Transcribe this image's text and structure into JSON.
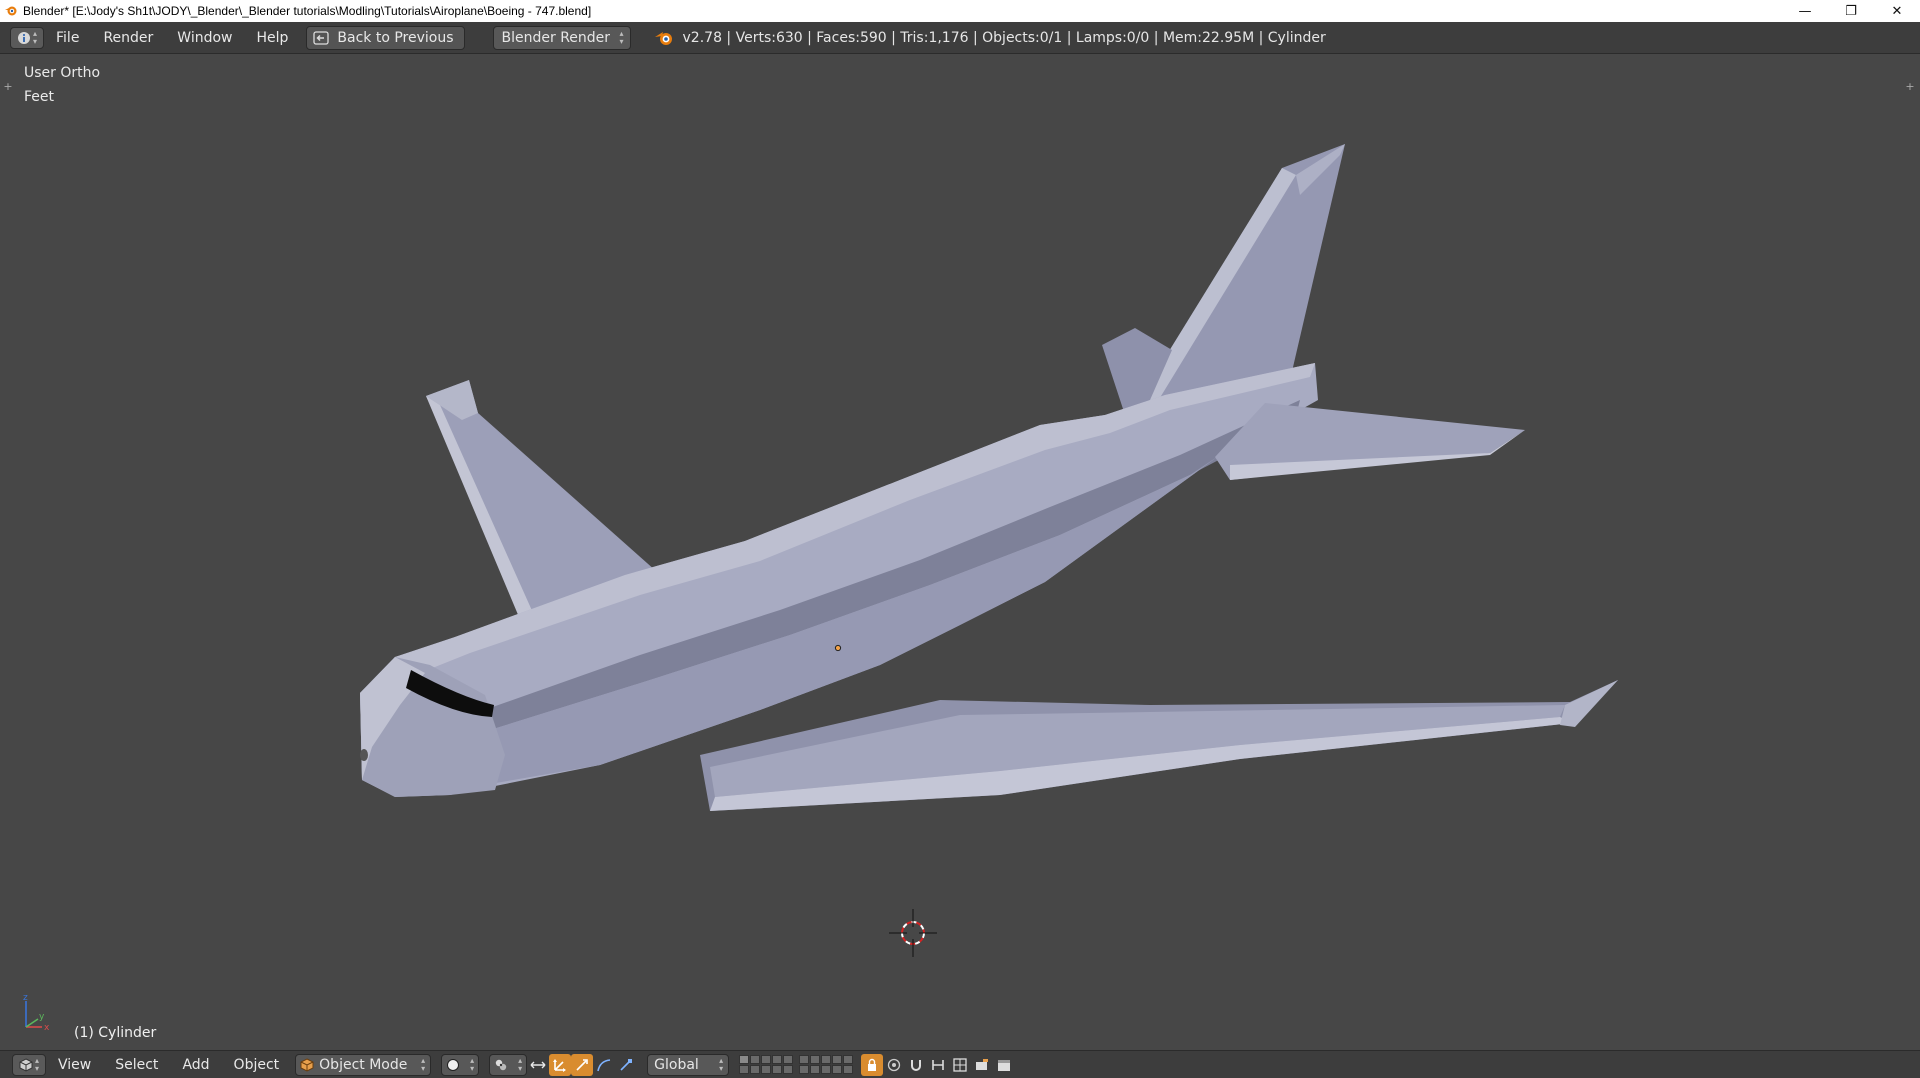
{
  "window": {
    "title": "Blender* [E:\\Jody's Sh1t\\JODY\\_Blender\\_Blender tutorials\\Modling\\Tutorials\\Airoplane\\Boeing - 747.blend]",
    "minimize": "—",
    "maximize": "❐",
    "close": "✕"
  },
  "info_header": {
    "menus": [
      "File",
      "Render",
      "Window",
      "Help"
    ],
    "back_label": "Back to Previous",
    "render_engine": "Blender Render",
    "stats": "v2.78 | Verts:630 | Faces:590 | Tris:1,176 | Objects:0/1 | Lamps:0/0 | Mem:22.95M | Cylinder"
  },
  "viewport": {
    "view_name": "User Ortho",
    "units": "Feet",
    "active_object": "(1) Cylinder",
    "gizmo": {
      "x": "x",
      "y": "y",
      "z": "z"
    }
  },
  "view_header": {
    "menus": [
      "View",
      "Select",
      "Add",
      "Object"
    ],
    "mode": "Object Mode",
    "orientation": "Global"
  },
  "icons": {
    "info_editor": "info-icon",
    "back": "back-icon",
    "blender_logo": "blender-logo-icon",
    "cube": "cube-icon",
    "shading": "solid-sphere-icon",
    "pivot": "pivot-icon",
    "manipulator": "manipulator-icon",
    "translate": "translate-icon",
    "rotate": "rotate-icon",
    "scale": "scale-icon",
    "render_preview": "render-icon",
    "camera": "camera-icon",
    "3d_cursor": "3d-cursor-icon"
  },
  "colors": {
    "ui_bg": "#3d3d3d",
    "viewport_bg": "#474747",
    "active_tool": "#d98c2f",
    "mesh_light": "#b9bccf",
    "mesh_mid": "#9a9db6",
    "mesh_dark": "#7b7e98"
  }
}
